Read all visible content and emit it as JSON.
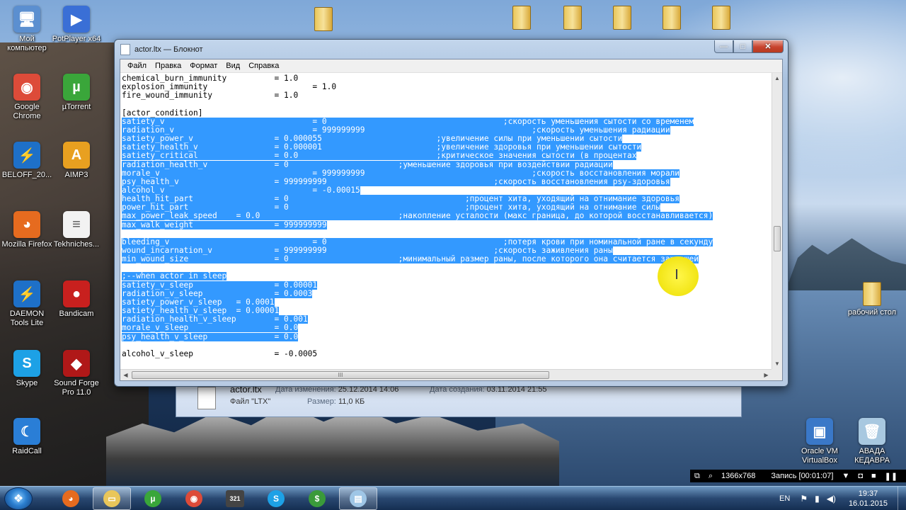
{
  "desktop": {
    "left_icons": [
      {
        "label": "Мой компьютер",
        "icon": "computer-icon",
        "color": "#5b8fd0",
        "glyph": "🖥"
      },
      {
        "label": "PotPlayer x64",
        "icon": "potplayer-icon",
        "color": "#3a6fd6",
        "glyph": "▶"
      },
      {
        "label": "Google Chrome",
        "icon": "chrome-icon",
        "color": "#dd4b39",
        "glyph": "◉"
      },
      {
        "label": "µTorrent",
        "icon": "utorrent-icon",
        "color": "#3aa63a",
        "glyph": "µ"
      },
      {
        "label": "BELOFF_20...",
        "icon": "beloff-icon",
        "color": "#1e70c8",
        "glyph": "⚡"
      },
      {
        "label": "AIMP3",
        "icon": "aimp-icon",
        "color": "#e8a020",
        "glyph": "A"
      },
      {
        "label": "Mozilla Firefox",
        "icon": "firefox-icon",
        "color": "#e66b1f",
        "glyph": "◕"
      },
      {
        "label": "Tekhniches...",
        "icon": "document-icon",
        "color": "#f2f2f2",
        "glyph": "≡"
      },
      {
        "label": "DAEMON Tools Lite",
        "icon": "daemon-tools-icon",
        "color": "#1e70c8",
        "glyph": "⚡"
      },
      {
        "label": "Bandicam",
        "icon": "bandicam-icon",
        "color": "#c8201e",
        "glyph": "●"
      },
      {
        "label": "Skype",
        "icon": "skype-icon",
        "color": "#1da1e6",
        "glyph": "S"
      },
      {
        "label": "Sound Forge Pro 11.0",
        "icon": "sound-forge-icon",
        "color": "#b01818",
        "glyph": "◆"
      },
      {
        "label": "RaidCall",
        "icon": "raidcall-icon",
        "color": "#2a7ed6",
        "glyph": "☾"
      }
    ],
    "right_icons": [
      {
        "label": "рабочий стол",
        "icon": "folder-icon",
        "color": "#e9c65a",
        "glyph": ""
      },
      {
        "label": "Oracle VM VirtualBox",
        "icon": "virtualbox-icon",
        "color": "#3a78c8",
        "glyph": "▣"
      },
      {
        "label": "АВАДА КЕДАВРА",
        "icon": "recycle-bin-icon",
        "color": "#a8c8e0",
        "glyph": "🗑"
      }
    ]
  },
  "window": {
    "title": "actor.ltx — Блокнот",
    "buttons": {
      "minimize": "—",
      "maximize": "□",
      "close": "✕"
    },
    "menu": [
      "Файл",
      "Правка",
      "Формат",
      "Вид",
      "Справка"
    ],
    "hscroll_grip": "III",
    "lines": [
      {
        "text": "chemical_burn_immunity          = 1.0",
        "selected": false
      },
      {
        "text": "explosion_immunity                      = 1.0",
        "selected": false
      },
      {
        "text": "fire_wound_immunity             = 1.0",
        "selected": false
      },
      {
        "text": "",
        "selected": false
      },
      {
        "text": "[actor_condition]",
        "selected": false
      },
      {
        "text": "satiety_v                               = 0                                     ;скорость уменьшения сытости со временем",
        "selected": true
      },
      {
        "text": "radiation_v                             = 999999999                                   ;скорость уменьшения радиации",
        "selected": true
      },
      {
        "text": "satiety_power_v                 = 0.000055                        ;увеличение силы при уменьшении сытости",
        "selected": true
      },
      {
        "text": "satiety_health_v                = 0.000001                        ;увеличение здоровья при уменьшении сытости",
        "selected": true
      },
      {
        "text": "satiety_critical                = 0.0                             ;критическое значения сытости (в процентах",
        "selected": true
      },
      {
        "text": "radiation_health_v              = 0                       ;уменьшение здоровья при воздействии радиации",
        "selected": true
      },
      {
        "text": "morale_v                                = 999999999                                   ;скорость восстановления морали",
        "selected": true
      },
      {
        "text": "psy_health_v                    = 999999999                                   ;скорость восстановления psy-здоровья",
        "selected": true
      },
      {
        "text": "alcohol_v                               = -0.00015",
        "selected": true
      },
      {
        "text": "health_hit_part                 = 0                                     ;процент хита, уходящий на отнимание здоровья",
        "selected": true
      },
      {
        "text": "power_hit_part                  = 0                                     ;процент хита, уходящий на отнимание силы",
        "selected": true
      },
      {
        "text": "max_power_leak_speed    = 0.0                             ;накопление усталости (макс граница, до которой восстанавливается)",
        "selected": true
      },
      {
        "text": "max_walk_weight                 = 999999999",
        "selected": true
      },
      {
        "text": "",
        "selected": false
      },
      {
        "text": "bleeding_v                              = 0                                     ;потеря крови при номинальной ране в секунду",
        "selected": true
      },
      {
        "text": "wound_incarnation_v             = 999999999                                   ;скорость заживления раны",
        "selected": true
      },
      {
        "text": "min_wound_size                  = 0                       ;минимальный размер раны, после которого она считается зажившей",
        "selected": true
      },
      {
        "text": "",
        "selected": false
      },
      {
        "text": ";--when actor in sleep",
        "selected": true
      },
      {
        "text": "satiety_v_sleep                 = 0.00001",
        "selected": true
      },
      {
        "text": "radiation_v_sleep               = 0.0003",
        "selected": true
      },
      {
        "text": "satiety_power_v_sleep   = 0.0001",
        "selected": true
      },
      {
        "text": "satiety_health_v_sleep  = 0.00001",
        "selected": true
      },
      {
        "text": "radiation_health_v_sleep        = 0.001",
        "selected": true
      },
      {
        "text": "morale_v_sleep                  = 0.0",
        "selected": true
      },
      {
        "text": "psy_health_v_sleep              = 0.0",
        "selected": true
      },
      {
        "text": "",
        "selected": false
      },
      {
        "text": "alcohol_v_sleep                 = -0.0005",
        "selected": false
      }
    ]
  },
  "explorer_details": {
    "filename": "actor.ltx",
    "modified_label": "Дата изменения:",
    "modified_value": "25.12.2014 14:06",
    "created_label": "Дата создания:",
    "created_value": "03.11.2014 21:55",
    "type": "Файл \"LTX\"",
    "size_label": "Размер:",
    "size_value": "11,0 КБ"
  },
  "recorder": {
    "resolution": "1366x768",
    "status": "Запись [00:01:07]"
  },
  "taskbar": {
    "apps": [
      {
        "name": "firefox",
        "icon": "firefox-icon",
        "glyph": "◕",
        "color": "#e66b1f"
      },
      {
        "name": "explorer",
        "icon": "folder-icon",
        "glyph": "▭",
        "color": "#e9c65a"
      },
      {
        "name": "utorrent",
        "icon": "utorrent-icon",
        "glyph": "µ",
        "color": "#3aa63a"
      },
      {
        "name": "chrome",
        "icon": "chrome-icon",
        "glyph": "◉",
        "color": "#dd4b39"
      },
      {
        "name": "calendar",
        "icon": "calendar-icon",
        "glyph": "321",
        "color": "#444444"
      },
      {
        "name": "skype",
        "icon": "skype-icon",
        "glyph": "S",
        "color": "#1da1e6"
      },
      {
        "name": "money",
        "icon": "money-icon",
        "glyph": "$",
        "color": "#3a9a3a"
      },
      {
        "name": "notepad",
        "icon": "notepad-icon",
        "glyph": "▤",
        "color": "#9fc6e6"
      }
    ],
    "language": "EN",
    "time": "19:37",
    "date": "16.01.2015"
  }
}
